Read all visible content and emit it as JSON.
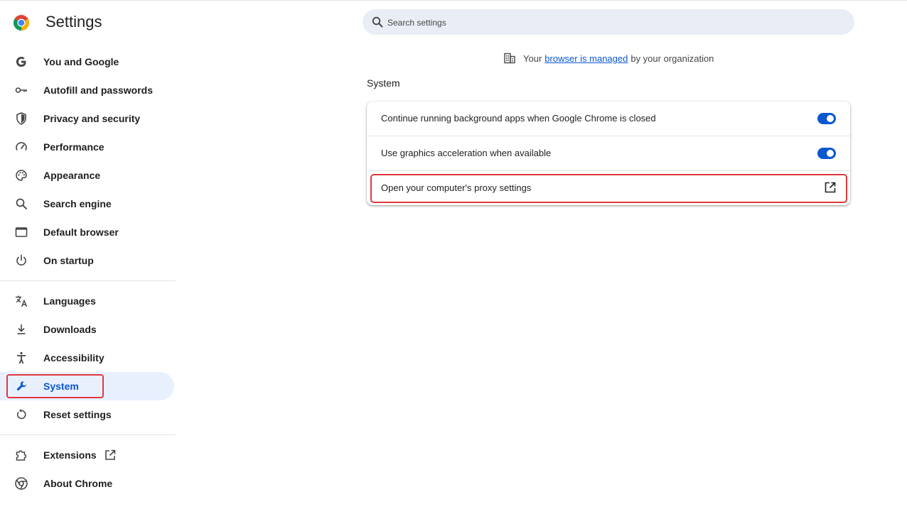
{
  "app": {
    "title": "Settings",
    "logo_icon": "chrome-logo-icon"
  },
  "search": {
    "placeholder": "Search settings",
    "value": ""
  },
  "managed_notice": {
    "prefix": "Your",
    "link": "browser is managed",
    "suffix": "by your organization",
    "icon": "building-icon"
  },
  "sidebar": {
    "groups": [
      [
        {
          "label": "You and Google",
          "icon": "google-g-icon"
        },
        {
          "label": "Autofill and passwords",
          "icon": "key-icon"
        },
        {
          "label": "Privacy and security",
          "icon": "shield-icon"
        },
        {
          "label": "Performance",
          "icon": "speedometer-icon"
        },
        {
          "label": "Appearance",
          "icon": "palette-icon"
        },
        {
          "label": "Search engine",
          "icon": "search-icon"
        },
        {
          "label": "Default browser",
          "icon": "browser-window-icon"
        },
        {
          "label": "On startup",
          "icon": "power-icon"
        }
      ],
      [
        {
          "label": "Languages",
          "icon": "translate-icon"
        },
        {
          "label": "Downloads",
          "icon": "download-icon"
        },
        {
          "label": "Accessibility",
          "icon": "accessibility-icon"
        },
        {
          "label": "System",
          "icon": "wrench-icon",
          "active": true
        },
        {
          "label": "Reset settings",
          "icon": "reset-icon"
        }
      ],
      [
        {
          "label": "Extensions",
          "icon": "puzzle-icon",
          "external": true
        },
        {
          "label": "About Chrome",
          "icon": "chrome-icon"
        }
      ]
    ]
  },
  "main": {
    "section_title": "System",
    "rows": [
      {
        "label": "Continue running background apps when Google Chrome is closed",
        "control": "toggle",
        "on": true
      },
      {
        "label": "Use graphics acceleration when available",
        "control": "toggle",
        "on": true
      },
      {
        "label": "Open your computer's proxy settings",
        "control": "external-link"
      }
    ]
  },
  "colors": {
    "accent": "#0b57d0",
    "highlight": "#e0383e",
    "active_bg": "#e8f0fe"
  }
}
